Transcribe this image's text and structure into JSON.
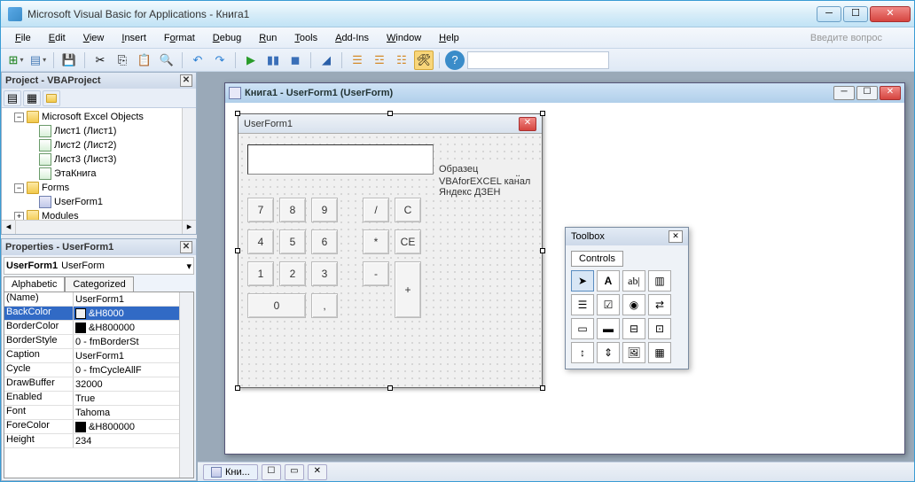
{
  "title": "Microsoft Visual Basic for Applications - Книга1",
  "ask_placeholder": "Введите вопрос",
  "menu": {
    "file": "File",
    "edit": "Edit",
    "view": "View",
    "insert": "Insert",
    "format": "Format",
    "debug": "Debug",
    "run": "Run",
    "tools": "Tools",
    "addins": "Add-Ins",
    "window": "Window",
    "help": "Help"
  },
  "project_panel": {
    "title": "Project - VBAProject",
    "nodes": {
      "excel_objects": "Microsoft Excel Objects",
      "sheet1": "Лист1 (Лист1)",
      "sheet2": "Лист2 (Лист2)",
      "sheet3": "Лист3 (Лист3)",
      "workbook": "ЭтаКнига",
      "forms": "Forms",
      "userform1": "UserForm1",
      "modules": "Modules"
    }
  },
  "props_panel": {
    "title": "Properties - UserForm1",
    "object_name": "UserForm1",
    "object_type": "UserForm",
    "tab_alpha": "Alphabetic",
    "tab_cat": "Categorized",
    "rows": [
      {
        "n": "(Name)",
        "v": "UserForm1"
      },
      {
        "n": "BackColor",
        "v": "&H8000",
        "sel": true,
        "swatch": "#f0f0f0",
        "dd": true
      },
      {
        "n": "BorderColor",
        "v": "&H800000",
        "swatch": "#000000"
      },
      {
        "n": "BorderStyle",
        "v": "0 - fmBorderSt"
      },
      {
        "n": "Caption",
        "v": "UserForm1"
      },
      {
        "n": "Cycle",
        "v": "0 - fmCycleAllF"
      },
      {
        "n": "DrawBuffer",
        "v": "32000"
      },
      {
        "n": "Enabled",
        "v": "True"
      },
      {
        "n": "Font",
        "v": "Tahoma"
      },
      {
        "n": "ForeColor",
        "v": "&H800000",
        "swatch": "#000000"
      },
      {
        "n": "Height",
        "v": "234"
      }
    ]
  },
  "designer": {
    "window_title": "Книга1 - UserForm1 (UserForm)",
    "form_caption": "UserForm1",
    "label1": "Образец пользовательской формы",
    "label2": "VBAforEXCEL канал Яндекс ДЗЕН",
    "buttons": {
      "b7": "7",
      "b8": "8",
      "b9": "9",
      "bdiv": "/",
      "bc": "C",
      "b4": "4",
      "b5": "5",
      "b6": "6",
      "bmul": "*",
      "bce": "CE",
      "b1": "1",
      "b2": "2",
      "b3": "3",
      "bmin": "-",
      "bpls": "+",
      "b0": "0",
      "bcom": ","
    }
  },
  "toolbox": {
    "title": "Toolbox",
    "tab": "Controls"
  },
  "taskbar": {
    "item": "Кни..."
  }
}
